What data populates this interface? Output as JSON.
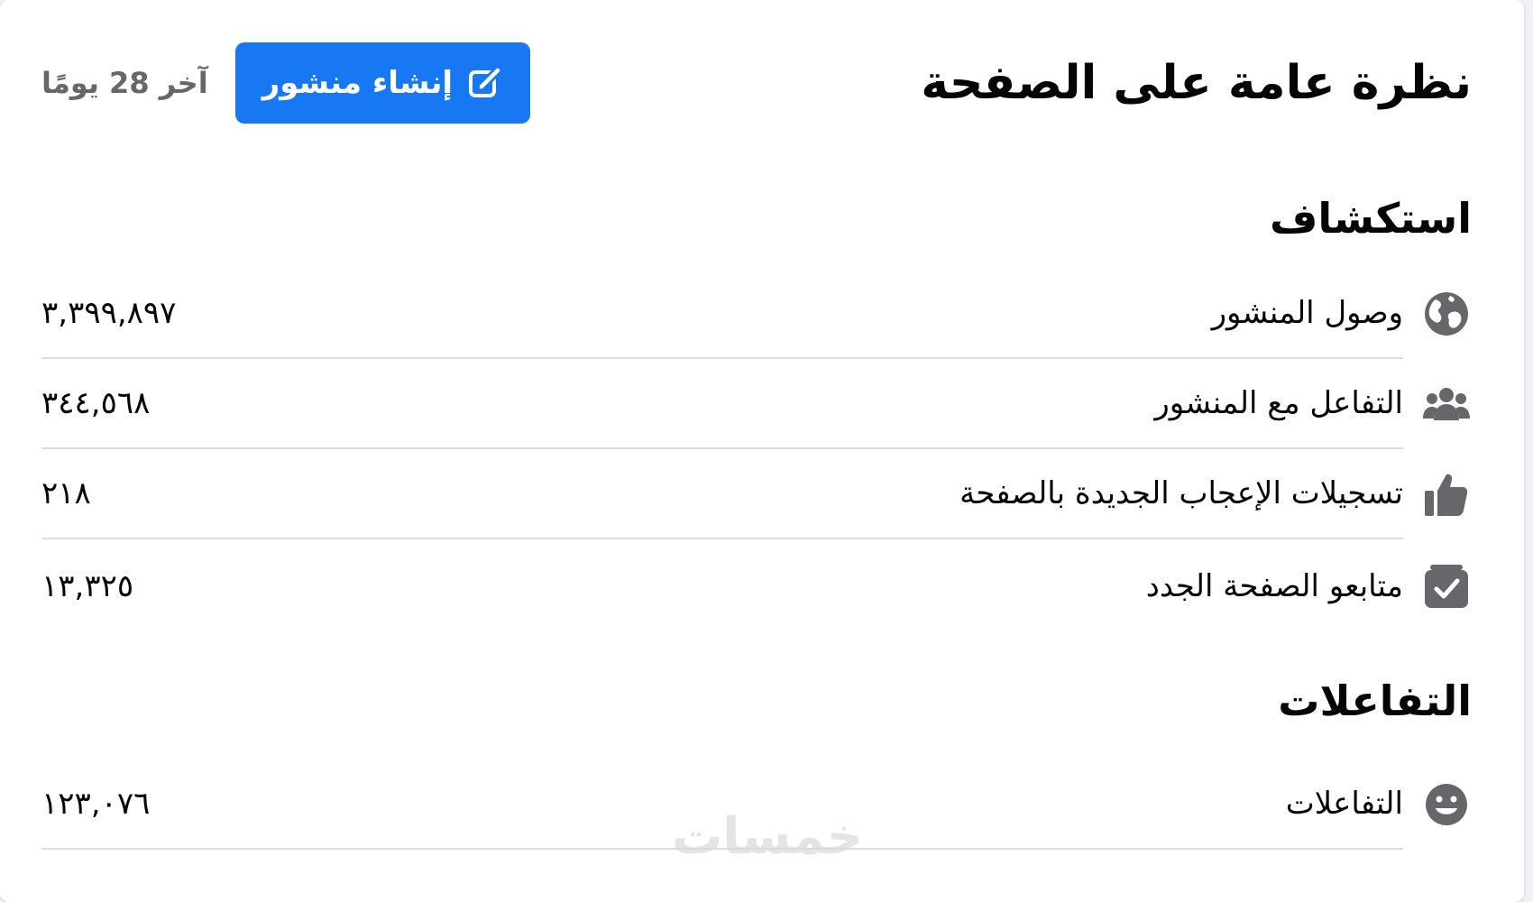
{
  "header": {
    "title": "نظرة عامة على الصفحة",
    "create_post_label": "إنشاء منشور",
    "create_post_icon": "edit-square-icon",
    "period": "آخر 28 يومًا"
  },
  "colors": {
    "accent": "#1877f2",
    "icon_gray": "#65676b",
    "divider": "#dadde1"
  },
  "discovery": {
    "title": "استكشاف",
    "rows": [
      {
        "label": "وصول المنشور",
        "value": "٣,٣٩٩,٨٩٧",
        "icon": "globe-icon"
      },
      {
        "label": "التفاعل مع المنشور",
        "value": "٣٤٤,٥٦٨",
        "icon": "people-icon"
      },
      {
        "label": "تسجيلات الإعجاب الجديدة بالصفحة",
        "value": "٢١٨",
        "icon": "thumbs-up-icon"
      },
      {
        "label": "متابعو الصفحة الجدد",
        "value": "١٣,٣٢٥",
        "icon": "follow-check-icon"
      }
    ]
  },
  "interactions": {
    "title": "التفاعلات",
    "rows": [
      {
        "label": "التفاعلات",
        "value": "١٢٣,٠٧٦",
        "icon": "smiley-icon"
      }
    ]
  },
  "watermark": {
    "text": "خمسات"
  }
}
